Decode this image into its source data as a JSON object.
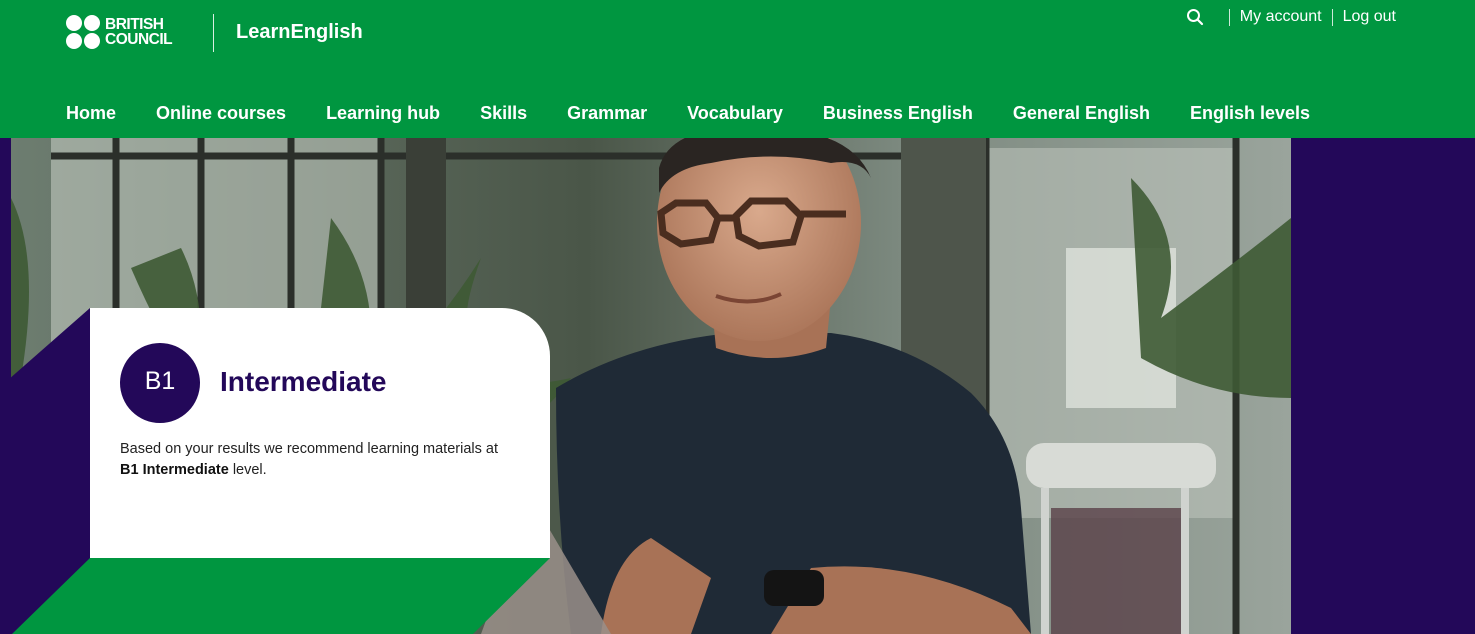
{
  "brand": {
    "logo_line1": "BRITISH",
    "logo_line2": "COUNCIL",
    "site_name": "LearnEnglish"
  },
  "utility": {
    "search_icon": "search-icon",
    "my_account": "My account",
    "log_out": "Log out"
  },
  "nav": {
    "items": [
      {
        "label": "Home"
      },
      {
        "label": "Online courses"
      },
      {
        "label": "Learning hub"
      },
      {
        "label": "Skills"
      },
      {
        "label": "Grammar"
      },
      {
        "label": "Vocabulary"
      },
      {
        "label": "Business English"
      },
      {
        "label": "General English"
      },
      {
        "label": "English levels"
      }
    ]
  },
  "result": {
    "badge": "B1",
    "title": "Intermediate",
    "desc_prefix": "Based on your results we recommend learning materials at ",
    "desc_bold": "B1 Intermediate",
    "desc_suffix": " level."
  },
  "colors": {
    "brand_green": "#009640",
    "brand_purple": "#230859",
    "text_dark": "#222222"
  }
}
